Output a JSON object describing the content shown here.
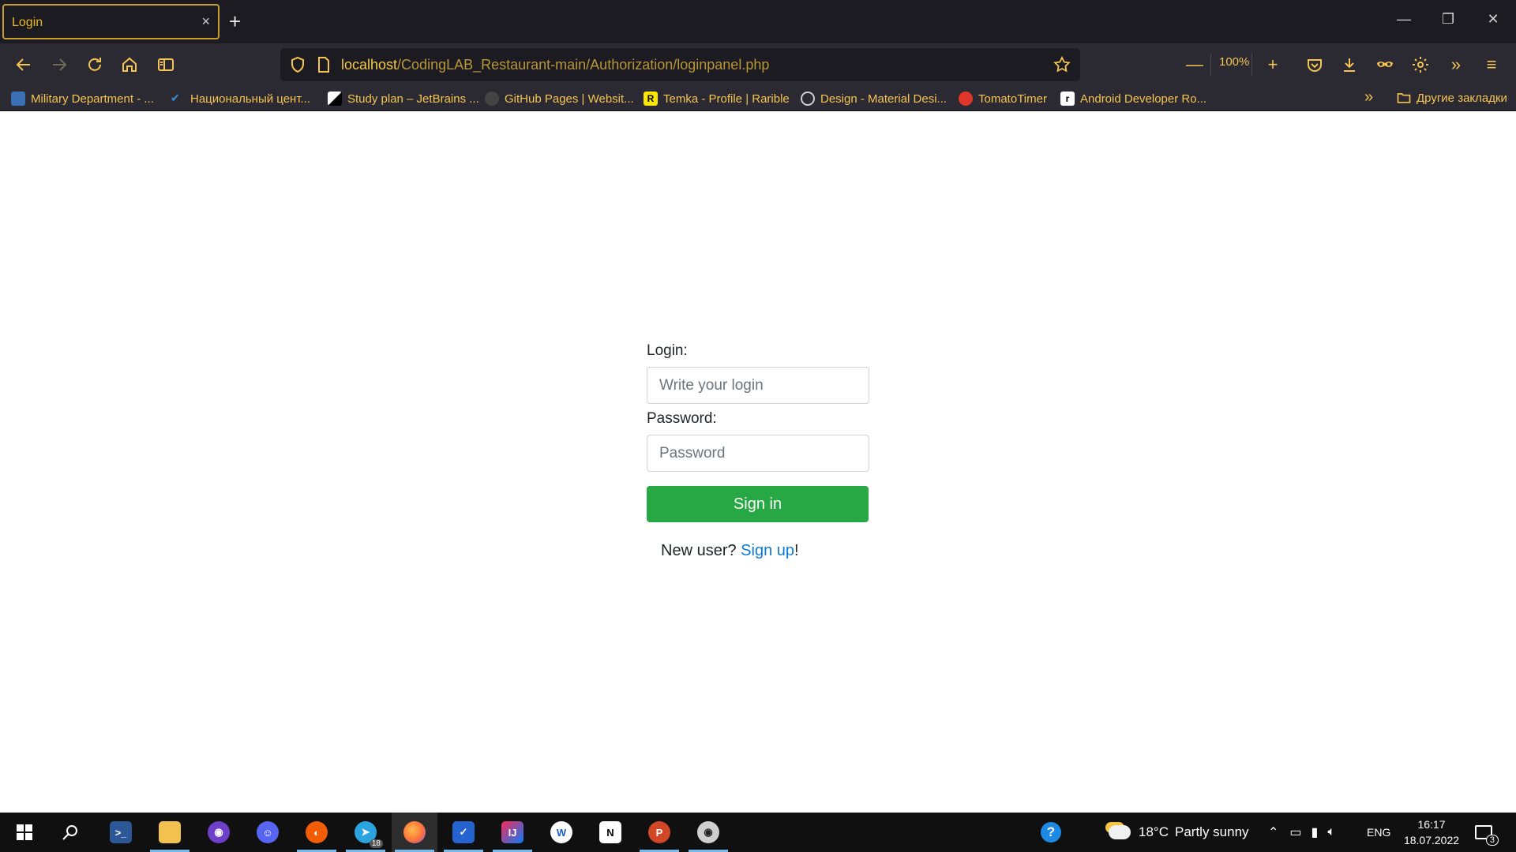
{
  "browser": {
    "tab_title": "Login",
    "tab_close": "×",
    "new_tab": "+",
    "url_host": "localhost",
    "url_path": "/CodingLAB_Restaurant-main/Authorization/loginpanel.php",
    "zoom_level": "100%",
    "accent_color": "#f5c451"
  },
  "bookmarks": [
    {
      "label": "Military Department - ...",
      "icon": "crest-icon",
      "color": "#3b6fb6"
    },
    {
      "label": "Национальный цент...",
      "icon": "check-icon",
      "color": "#3a8fd8"
    },
    {
      "label": "Study plan – JetBrains ...",
      "icon": "jetbrains-icon",
      "color": "#ffffff"
    },
    {
      "label": "GitHub Pages | Websit...",
      "icon": "github-icon",
      "color": "#444444"
    },
    {
      "label": "Temka - Profile | Rarible",
      "icon": "rarible-icon",
      "color": "#fee603"
    },
    {
      "label": "Design - Material Desi...",
      "icon": "globe-icon",
      "color": "#cfcfcf"
    },
    {
      "label": "TomatoTimer",
      "icon": "tomato-icon",
      "color": "#e0352b"
    },
    {
      "label": "Android Developer Ro...",
      "icon": "roadmap-icon",
      "color": "#ffffff"
    }
  ],
  "bookmarks_other": "Другие закладки",
  "login_form": {
    "login_label": "Login:",
    "login_placeholder": "Write your login",
    "password_label": "Password:",
    "password_placeholder": "Password",
    "submit_label": "Sign in",
    "new_user_text": "New user? ",
    "signup_link": "Sign up",
    "signup_suffix": "!",
    "button_color": "#28a745",
    "link_color": "#0b7bd6"
  },
  "taskbar": {
    "apps": [
      {
        "name": "powershell",
        "icon": "powershell-icon",
        "color": "#2b5797",
        "glyph": ">_"
      },
      {
        "name": "file-explorer",
        "icon": "folder-icon",
        "color": "#f2c14e",
        "glyph": ""
      },
      {
        "name": "github-desktop",
        "icon": "github-desktop-icon",
        "color": "#6e40c9",
        "glyph": "◉"
      },
      {
        "name": "discord",
        "icon": "discord-icon",
        "color": "#5865f2",
        "glyph": "☺"
      },
      {
        "name": "music",
        "icon": "music-icon",
        "color": "#f25c05",
        "glyph": "◐"
      },
      {
        "name": "telegram",
        "icon": "telegram-icon",
        "color": "#2aa3df",
        "glyph": "➤"
      },
      {
        "name": "firefox",
        "icon": "firefox-icon",
        "color": "#ff7139",
        "glyph": "●"
      },
      {
        "name": "todo",
        "icon": "todo-icon",
        "color": "#2564cf",
        "glyph": "✓"
      },
      {
        "name": "intellij",
        "icon": "intellij-icon",
        "color": "#087cfa",
        "glyph": "IJ"
      },
      {
        "name": "word",
        "icon": "word-icon",
        "color": "#1a5dc7",
        "glyph": "W"
      },
      {
        "name": "notion",
        "icon": "notion-icon",
        "color": "#ffffff",
        "glyph": "N"
      },
      {
        "name": "powerpoint",
        "icon": "powerpoint-icon",
        "color": "#d24726",
        "glyph": "P"
      },
      {
        "name": "github-2",
        "icon": "github-icon",
        "color": "#cfcfcf",
        "glyph": "◉"
      }
    ],
    "telegram_badge": "18",
    "weather_temp": "18°C",
    "weather_text": "Partly sunny",
    "language": "ENG",
    "time": "16:17",
    "date": "18.07.2022",
    "notification_count": "3"
  }
}
